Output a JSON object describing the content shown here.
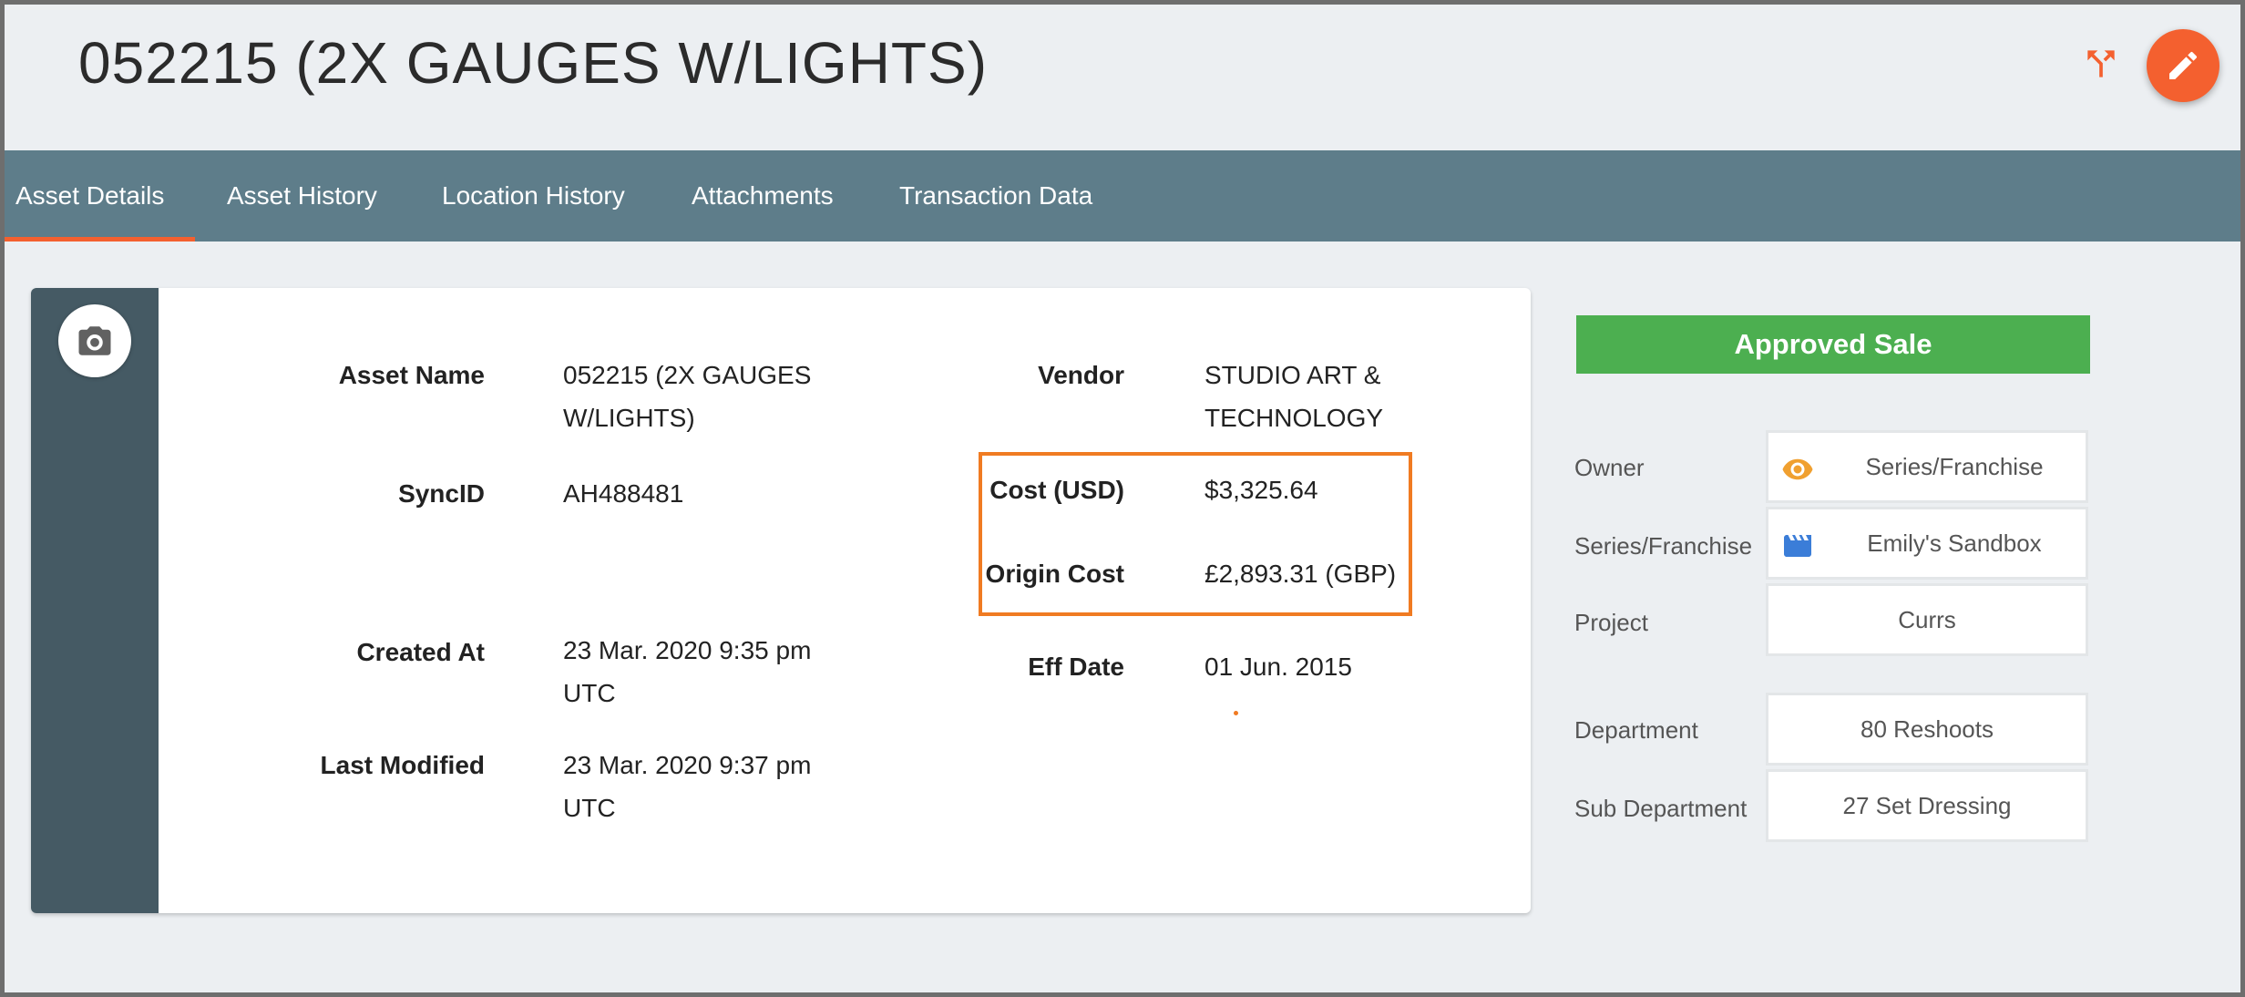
{
  "header": {
    "title": "052215 (2X GAUGES W/LIGHTS)",
    "split_icon": "split-arrow-icon",
    "edit_icon": "pencil-icon"
  },
  "tabs": [
    {
      "label": "Asset Details",
      "active": true
    },
    {
      "label": "Asset History",
      "active": false
    },
    {
      "label": "Location History",
      "active": false
    },
    {
      "label": "Attachments",
      "active": false
    },
    {
      "label": "Transaction Data",
      "active": false
    }
  ],
  "details": {
    "asset_name_label": "Asset Name",
    "asset_name_line1": "052215 (2X GAUGES",
    "asset_name_line2": "W/LIGHTS)",
    "syncid_label": "SyncID",
    "syncid_value": "AH488481",
    "created_label": "Created At",
    "created_line1": "23 Mar. 2020 9:35 pm",
    "created_line2": "UTC",
    "modified_label": "Last Modified",
    "modified_line1": "23 Mar. 2020 9:37 pm",
    "modified_line2": "UTC",
    "vendor_label": "Vendor",
    "vendor_line1": "STUDIO ART &",
    "vendor_line2": "TECHNOLOGY",
    "cost_label": "Cost (USD)",
    "cost_value": "$3,325.64",
    "origin_cost_label": "Origin Cost",
    "origin_cost_value": "£2,893.31 (GBP)",
    "eff_date_label": "Eff Date",
    "eff_date_value": "01 Jun. 2015"
  },
  "side_panel": {
    "status": "Approved Sale",
    "status_color": "#4caf50",
    "rows": [
      {
        "label": "Owner",
        "value": "Series/Franchise",
        "icon": "eye-icon"
      },
      {
        "label": "Series/Franchise",
        "value": "Emily's Sandbox",
        "icon": "clapperboard-icon"
      },
      {
        "label": "Project",
        "value": "Currs"
      },
      {
        "label": "Department",
        "value": "80 Reshoots"
      },
      {
        "label": "Sub Department",
        "value": "27 Set Dressing"
      }
    ]
  },
  "colors": {
    "accent": "#f4602f",
    "tabbar": "#5e7d8a",
    "highlight": "#f07b22"
  }
}
